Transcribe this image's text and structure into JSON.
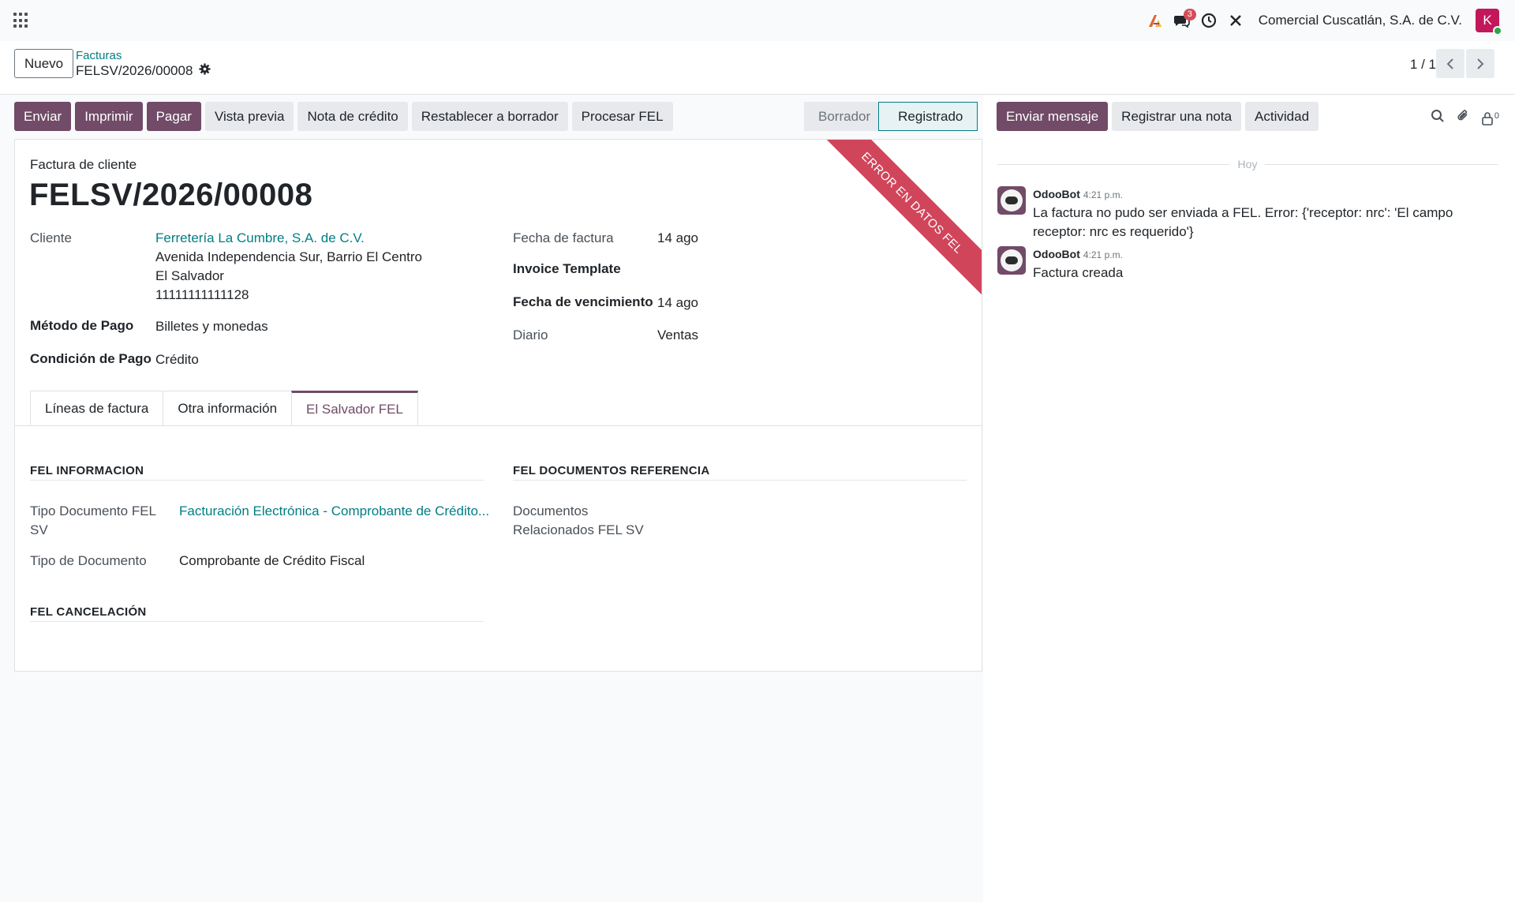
{
  "navbar": {
    "company": "Comercial Cuscatlán, S.A. de C.V.",
    "messages_badge": "3",
    "avatar_letter": "K"
  },
  "control": {
    "new_label": "Nuevo",
    "breadcrumb_parent": "Facturas",
    "breadcrumb_current": "FELSV/2026/00008",
    "pager": "1 / 1"
  },
  "actions": {
    "buttons": [
      {
        "label": "Enviar",
        "style": "primary"
      },
      {
        "label": "Imprimir",
        "style": "primary"
      },
      {
        "label": "Pagar",
        "style": "primary"
      },
      {
        "label": "Vista previa",
        "style": "secondary"
      },
      {
        "label": "Nota de crédito",
        "style": "secondary"
      },
      {
        "label": "Restablecer a borrador",
        "style": "secondary"
      },
      {
        "label": "Procesar FEL",
        "style": "secondary"
      }
    ],
    "status": {
      "draft": "Borrador",
      "posted": "Registrado"
    }
  },
  "form": {
    "ribbon": "ERROR EN DATOS FEL",
    "doc_type": "Factura de cliente",
    "title": "FELSV/2026/00008",
    "customer_label": "Cliente",
    "customer_name": "Ferretería La Cumbre, S.A. de C.V.",
    "customer_address1": "Avenida Independencia Sur, Barrio El Centro",
    "customer_address2": "El Salvador",
    "customer_vat": "11111111111128",
    "payment_method_label": "Método de Pago",
    "payment_method": "Billetes y monedas",
    "payment_term_label": "Condición de Pago",
    "payment_term": "Crédito",
    "invoice_date_label": "Fecha de factura",
    "invoice_date": "14 ago",
    "template_label": "Invoice Template",
    "due_date_label": "Fecha de vencimiento",
    "due_date": "14 ago",
    "journal_label": "Diario",
    "journal": "Ventas",
    "tabs": [
      "Líneas de factura",
      "Otra información",
      "El Salvador FEL"
    ],
    "fel": {
      "info_title": "FEL INFORMACION",
      "doc_type_label_1": "Tipo Documento FEL",
      "doc_type_label_2": "SV",
      "doc_type_value": "Facturación Electrónica - Comprobante de Crédito...",
      "tipo_doc_label": "Tipo de Documento",
      "tipo_doc_value": "Comprobante de Crédito Fiscal",
      "ref_title": "FEL DOCUMENTOS REFERENCIA",
      "ref_label_1": "Documentos",
      "ref_label_2": "Relacionados FEL SV",
      "cancel_title": "FEL CANCELACIÓN"
    }
  },
  "chatter": {
    "send_message": "Enviar mensaje",
    "log_note": "Registrar una nota",
    "activity": "Actividad",
    "followers_count": "0",
    "today": "Hoy",
    "messages": [
      {
        "author": "OdooBot",
        "time": "4:21 p.m.",
        "text": "La factura no pudo ser enviada a FEL. Error: {'receptor: nrc': 'El campo receptor: nrc es requerido'}"
      },
      {
        "author": "OdooBot",
        "time": "4:21 p.m.",
        "text": "Factura creada"
      }
    ]
  },
  "colors": {
    "brand": "#714b67",
    "link": "#017e84",
    "ribbon": "#d1455b"
  }
}
